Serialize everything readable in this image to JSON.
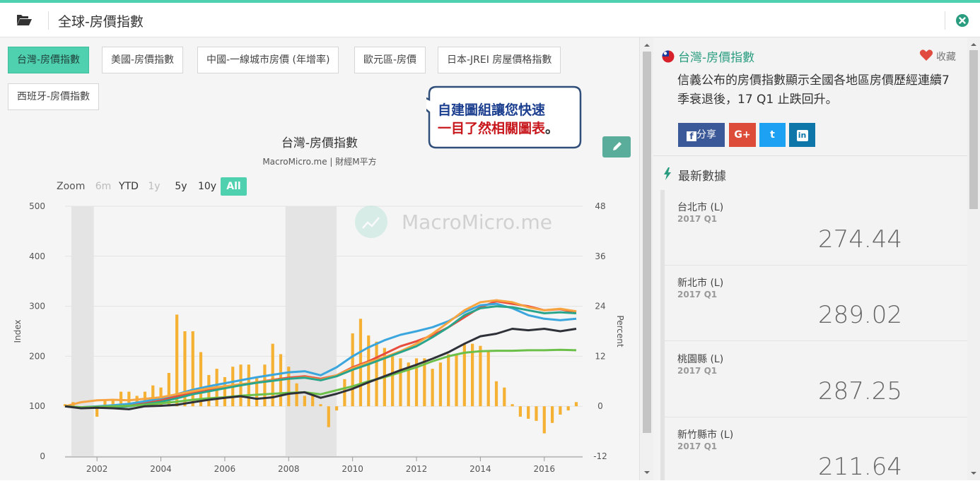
{
  "header": {
    "title": "全球-房價指數"
  },
  "tabs": [
    {
      "label": "台灣-房價指數",
      "active": true
    },
    {
      "label": "美國-房價指數",
      "active": false
    },
    {
      "label": "中國-一線城市房價 (年增率)",
      "active": false
    },
    {
      "label": "歐元區-房價",
      "active": false
    },
    {
      "label": "日本-JREI 房屋價格指數",
      "active": false
    },
    {
      "label": "西班牙-房價指數",
      "active": false
    }
  ],
  "callout": {
    "line1": "自建圖組讓您快速",
    "line2": "一目了然相關圖表",
    "punct": "。"
  },
  "chart_header": {
    "title": "台灣-房價指數",
    "subtitle": "MacroMicro.me | 財經M平方",
    "watermark": "MacroMicro.me"
  },
  "zoom": {
    "label": "Zoom",
    "buttons": [
      {
        "label": "6m",
        "state": "disabled"
      },
      {
        "label": "YTD",
        "state": "normal"
      },
      {
        "label": "1y",
        "state": "disabled"
      },
      {
        "label": "5y",
        "state": "normal"
      },
      {
        "label": "10y",
        "state": "normal"
      },
      {
        "label": "All",
        "state": "active"
      }
    ]
  },
  "chart_data": {
    "type": "line",
    "xlabel": "",
    "ylabel_left": "Index",
    "ylabel_right": "Percent",
    "ylim_left": [
      0,
      500
    ],
    "ylim_right": [
      -12,
      48
    ],
    "yticks_left": [
      0,
      100,
      200,
      300,
      400,
      500
    ],
    "yticks_right": [
      -12,
      0,
      12,
      24,
      36,
      48
    ],
    "xticks": [
      2002,
      2004,
      2006,
      2008,
      2010,
      2012,
      2014,
      2016
    ],
    "xlim": [
      2001.0,
      2017.2
    ],
    "grid": true,
    "recession_bands": [
      [
        2001.2,
        2001.9
      ],
      [
        2007.9,
        2009.5
      ]
    ],
    "bars": {
      "color": "#f5b133",
      "axis": "right",
      "x": [
        2001.0,
        2001.25,
        2001.5,
        2001.75,
        2002.0,
        2002.25,
        2002.5,
        2002.75,
        2003.0,
        2003.25,
        2003.5,
        2003.75,
        2004.0,
        2004.25,
        2004.5,
        2004.75,
        2005.0,
        2005.25,
        2005.5,
        2005.75,
        2006.0,
        2006.25,
        2006.5,
        2006.75,
        2007.0,
        2007.25,
        2007.5,
        2007.75,
        2008.0,
        2008.25,
        2008.5,
        2008.75,
        2009.0,
        2009.25,
        2009.5,
        2009.75,
        2010.0,
        2010.25,
        2010.5,
        2010.75,
        2011.0,
        2011.25,
        2011.5,
        2011.75,
        2012.0,
        2012.25,
        2012.5,
        2012.75,
        2013.0,
        2013.25,
        2013.5,
        2013.75,
        2014.0,
        2014.25,
        2014.5,
        2014.75,
        2015.0,
        2015.25,
        2015.5,
        2015.75,
        2016.0,
        2016.25,
        2016.5,
        2016.75,
        2017.0
      ],
      "values": [
        0.5,
        1.0,
        0.0,
        -0.5,
        -2.5,
        1.5,
        1.5,
        3.5,
        3.5,
        2.5,
        3.5,
        5.0,
        4.5,
        8.0,
        22.0,
        18.0,
        18.0,
        13.0,
        7.5,
        9.0,
        7.0,
        9.5,
        10.0,
        10.0,
        7.0,
        10.0,
        15.0,
        12.5,
        9.5,
        5.5,
        2.5,
        3.0,
        0.5,
        -5.0,
        -1.0,
        6.5,
        17.5,
        21.0,
        17.0,
        15.5,
        14.0,
        12.0,
        11.5,
        10.5,
        11.5,
        11.5,
        9.0,
        10.5,
        12.5,
        12.5,
        15.0,
        15.0,
        14.5,
        13.5,
        6.0,
        4.5,
        0.5,
        -2.5,
        -3.0,
        -3.5,
        -6.5,
        -4.0,
        -2.0,
        -1.0,
        1.0
      ]
    },
    "x": [
      2001.0,
      2001.5,
      2002.0,
      2002.5,
      2003.0,
      2003.5,
      2004.0,
      2004.5,
      2005.0,
      2005.5,
      2006.0,
      2006.5,
      2007.0,
      2007.5,
      2008.0,
      2008.5,
      2009.0,
      2009.5,
      2010.0,
      2010.5,
      2011.0,
      2011.5,
      2012.0,
      2012.5,
      2013.0,
      2013.5,
      2014.0,
      2014.5,
      2015.0,
      2015.5,
      2016.0,
      2016.5,
      2017.0
    ],
    "series": [
      {
        "color": "#e84c3d",
        "values": [
          100,
          97,
          98,
          100,
          103,
          108,
          113,
          120,
          127,
          133,
          138,
          143,
          148,
          153,
          157,
          160,
          155,
          162,
          178,
          190,
          205,
          220,
          230,
          242,
          258,
          278,
          298,
          310,
          305,
          300,
          292,
          294,
          288
        ]
      },
      {
        "color": "#3aa6dd",
        "values": [
          100,
          98,
          100,
          102,
          105,
          110,
          116,
          124,
          133,
          140,
          146,
          152,
          158,
          163,
          168,
          170,
          162,
          178,
          200,
          218,
          232,
          243,
          250,
          258,
          270,
          288,
          302,
          305,
          296,
          282,
          275,
          272,
          275
        ]
      },
      {
        "color": "#f7a541",
        "values": [
          100,
          108,
          112,
          113,
          112,
          115,
          118,
          124,
          130,
          136,
          140,
          144,
          148,
          152,
          155,
          158,
          153,
          162,
          176,
          188,
          198,
          210,
          225,
          245,
          268,
          292,
          308,
          312,
          308,
          298,
          292,
          295,
          290
        ]
      },
      {
        "color": "#2aa58b",
        "values": [
          100,
          97,
          97,
          98,
          100,
          104,
          109,
          116,
          124,
          130,
          136,
          142,
          147,
          151,
          155,
          157,
          152,
          160,
          173,
          184,
          196,
          208,
          220,
          238,
          258,
          282,
          296,
          300,
          298,
          292,
          286,
          288,
          286
        ]
      },
      {
        "color": "#6cc04a",
        "values": [
          100,
          98,
          99,
          100,
          101,
          103,
          106,
          109,
          113,
          116,
          118,
          121,
          123,
          125,
          127,
          128,
          124,
          132,
          140,
          150,
          158,
          168,
          178,
          190,
          200,
          207,
          210,
          211,
          211,
          212,
          212,
          213,
          212
        ]
      },
      {
        "color": "#2e3138",
        "values": [
          100,
          96,
          97,
          96,
          94,
          100,
          101,
          103,
          108,
          113,
          117,
          120,
          115,
          118,
          125,
          128,
          117,
          125,
          135,
          148,
          160,
          172,
          183,
          195,
          208,
          225,
          240,
          245,
          255,
          252,
          255,
          250,
          255
        ]
      }
    ]
  },
  "sidebar": {
    "title": "台灣-房價指數",
    "favorite_label": "收藏",
    "description": "信義公布的房價指數顯示全國各地區房價歷經連續7季衰退後，17 Q1 止跌回升。",
    "share": {
      "facebook": "分享",
      "google": "G+",
      "twitter": "t",
      "linkedin": "in"
    },
    "latest_title": "最新數據",
    "items": [
      {
        "name": "台北市 (L)",
        "date": "2017 Q1",
        "value": "274.44"
      },
      {
        "name": "新北市 (L)",
        "date": "2017 Q1",
        "value": "289.02"
      },
      {
        "name": "桃園縣 (L)",
        "date": "2017 Q1",
        "value": "287.25"
      },
      {
        "name": "新竹縣市 (L)",
        "date": "2017 Q1",
        "value": "211.64"
      }
    ]
  },
  "colors": {
    "accent": "#4fd1b0",
    "title_green": "#2a9d80",
    "callout_blue": "#1c3f8f",
    "callout_red": "#c8171c"
  }
}
